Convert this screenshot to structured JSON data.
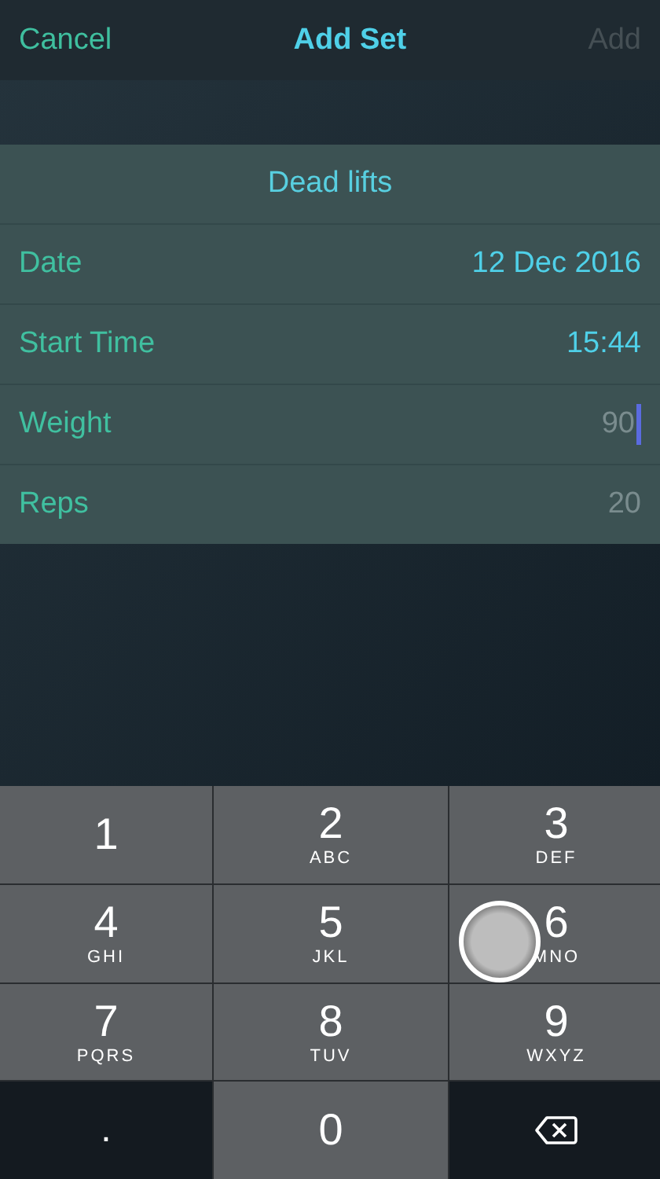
{
  "nav": {
    "cancel": "Cancel",
    "title": "Add Set",
    "add": {
      "label": "Add",
      "disabled": true
    }
  },
  "form": {
    "title": "Dead lifts",
    "rows": [
      {
        "kind": "value",
        "label": "Date",
        "value": "12 Dec 2016"
      },
      {
        "kind": "value",
        "label": "Start Time",
        "value": "15:44"
      },
      {
        "kind": "input",
        "label": "Weight",
        "placeholder": "90",
        "focused": true
      },
      {
        "kind": "input",
        "label": "Reps",
        "placeholder": "20",
        "focused": false
      }
    ]
  },
  "keypad": {
    "keys": [
      {
        "kind": "digit",
        "digit": "1"
      },
      {
        "kind": "digit",
        "digit": "2",
        "letters": "ABC"
      },
      {
        "kind": "digit",
        "digit": "3",
        "letters": "DEF"
      },
      {
        "kind": "digit",
        "digit": "4",
        "letters": "GHI"
      },
      {
        "kind": "digit",
        "digit": "5",
        "letters": "JKL"
      },
      {
        "kind": "digit",
        "digit": "6",
        "letters": "MNO",
        "touched": true
      },
      {
        "kind": "digit",
        "digit": "7",
        "letters": "PQRS"
      },
      {
        "kind": "digit",
        "digit": "8",
        "letters": "TUV"
      },
      {
        "kind": "digit",
        "digit": "9",
        "letters": "WXYZ"
      },
      {
        "kind": "dot",
        "digit": "."
      },
      {
        "kind": "digit",
        "digit": "0"
      },
      {
        "kind": "backspace"
      }
    ]
  }
}
